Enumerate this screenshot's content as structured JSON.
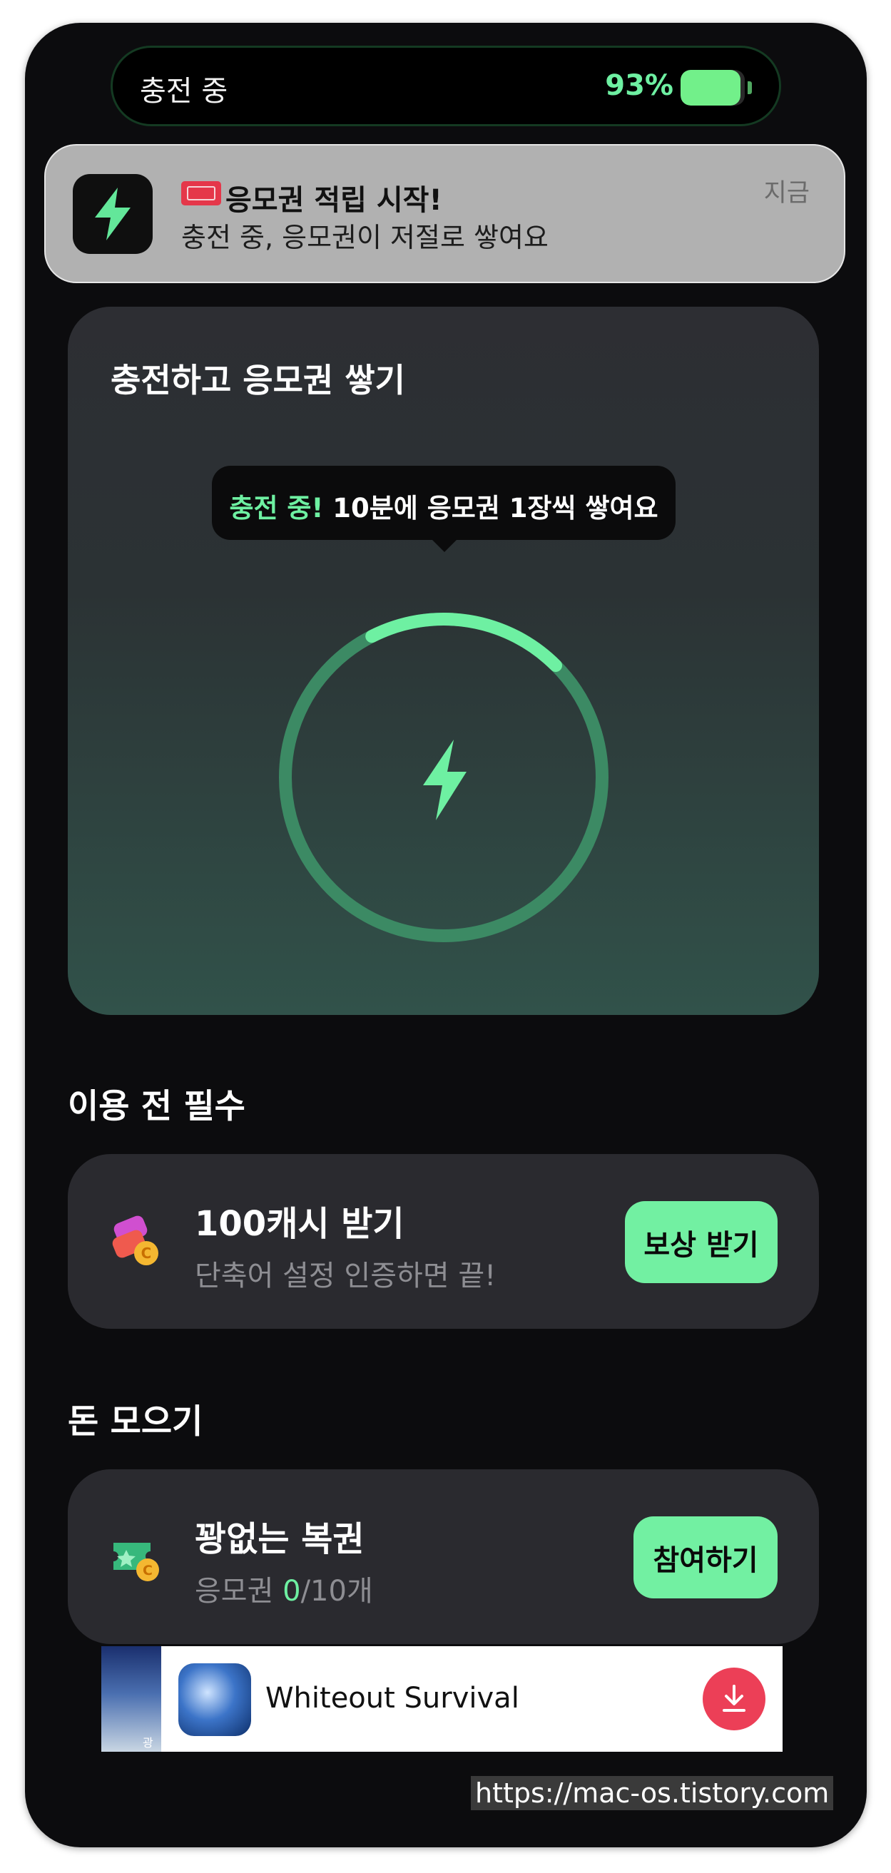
{
  "status_island": {
    "label": "충전 중",
    "battery_percent": "93%",
    "battery_level": 0.93,
    "accent_color": "#6ef0a2"
  },
  "notification": {
    "app_icon": "lightning-bolt-icon",
    "ticket_icon": "admit-one-ticket-icon",
    "title": "응모권 적립 시작!",
    "body": "충전 중, 응모권이 저절로 쌓여요",
    "time": "지금"
  },
  "charge_card": {
    "title": "충전하고 응모권 쌓기",
    "tooltip_highlight": "충전 중!",
    "tooltip_text": " 10분에 응모권 1장씩 쌓여요",
    "progress_fraction": 0.2,
    "center_icon": "lightning-bolt-icon"
  },
  "sections": {
    "required_title": "이용 전 필수",
    "collect_title": "돈 모으기"
  },
  "cash_card": {
    "icon": "shortcut-coin-icon",
    "title": "100캐시 받기",
    "subtitle": "단축어 설정 인증하면 끝!",
    "button": "보상 받기"
  },
  "lottery_card": {
    "icon": "ticket-coin-icon",
    "title": "꽝없는 복권",
    "subtitle_prefix": "응모권 ",
    "subtitle_count": "0",
    "subtitle_suffix": "/10개",
    "button": "참여하기"
  },
  "ad_banner": {
    "thumb_label": "광고",
    "app_name": "Whiteout Survival",
    "download_icon": "download-icon"
  },
  "watermark": "https://mac-os.tistory.com",
  "colors": {
    "accent": "#6ef0a2",
    "button": "#72f0a2",
    "card": "#2a2a2f",
    "background": "#0c0c0e"
  }
}
